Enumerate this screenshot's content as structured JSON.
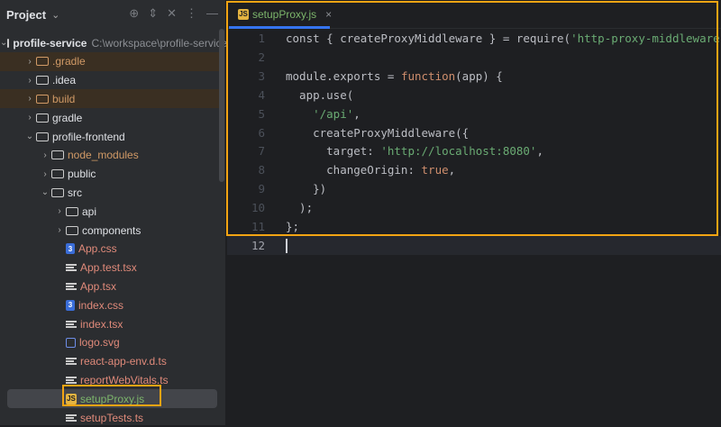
{
  "sidebar": {
    "title": "Project",
    "tools": [
      "target-icon",
      "expand-icon",
      "collapse-icon",
      "more-icon",
      "minimize-icon"
    ],
    "tree": [
      {
        "label": "profile-service",
        "path": "C:\\workspace\\profile-service",
        "level": 0,
        "type": "module",
        "expanded": true
      },
      {
        "label": ".gradle",
        "level": 1,
        "type": "folder",
        "excluded": true
      },
      {
        "label": ".idea",
        "level": 1,
        "type": "folder"
      },
      {
        "label": "build",
        "level": 1,
        "type": "folder",
        "excluded": true
      },
      {
        "label": "gradle",
        "level": 1,
        "type": "folder"
      },
      {
        "label": "profile-frontend",
        "level": 1,
        "type": "folder",
        "expanded": true
      },
      {
        "label": "node_modules",
        "level": 2,
        "type": "folder",
        "orange": true
      },
      {
        "label": "public",
        "level": 2,
        "type": "folder"
      },
      {
        "label": "src",
        "level": 2,
        "type": "folder",
        "expanded": true
      },
      {
        "label": "api",
        "level": 3,
        "type": "folder"
      },
      {
        "label": "components",
        "level": 3,
        "type": "folder"
      },
      {
        "label": "App.css",
        "level": 3,
        "type": "css"
      },
      {
        "label": "App.test.tsx",
        "level": 3,
        "type": "txt"
      },
      {
        "label": "App.tsx",
        "level": 3,
        "type": "txt"
      },
      {
        "label": "index.css",
        "level": 3,
        "type": "css"
      },
      {
        "label": "index.tsx",
        "level": 3,
        "type": "txt"
      },
      {
        "label": "logo.svg",
        "level": 3,
        "type": "img"
      },
      {
        "label": "react-app-env.d.ts",
        "level": 3,
        "type": "txt"
      },
      {
        "label": "reportWebVitals.ts",
        "level": 3,
        "type": "txt"
      },
      {
        "label": "setupProxy.js",
        "level": 3,
        "type": "js",
        "selected": true
      },
      {
        "label": "setupTests.ts",
        "level": 3,
        "type": "txt"
      }
    ]
  },
  "editor": {
    "tab": {
      "label": "setupProxy.js",
      "icon": "JS",
      "close": "×"
    },
    "lines": [
      [
        [
          "const { createProxyMiddleware } = require(",
          ""
        ],
        [
          "'http-proxy-middleware'",
          "str"
        ],
        [
          ");",
          ""
        ]
      ],
      [],
      [
        [
          "module.exports = ",
          ""
        ],
        [
          "function",
          "kw"
        ],
        [
          "(app) {",
          ""
        ]
      ],
      [
        [
          "  app.use(",
          ""
        ]
      ],
      [
        [
          "    ",
          ""
        ],
        [
          "'/api'",
          "str"
        ],
        [
          ",",
          ""
        ]
      ],
      [
        [
          "    createProxyMiddleware({",
          ""
        ]
      ],
      [
        [
          "      target: ",
          ""
        ],
        [
          "'http://localhost:8080'",
          "str"
        ],
        [
          ",",
          ""
        ]
      ],
      [
        [
          "      changeOrigin: ",
          ""
        ],
        [
          "true",
          "kw"
        ],
        [
          ",",
          ""
        ]
      ],
      [
        [
          "    })",
          ""
        ]
      ],
      [
        [
          "  );",
          ""
        ]
      ],
      [
        [
          "};",
          ""
        ]
      ],
      []
    ],
    "current_line": 12
  },
  "colors": {
    "highlight": "#f2a413",
    "accent": "#3574f0"
  }
}
